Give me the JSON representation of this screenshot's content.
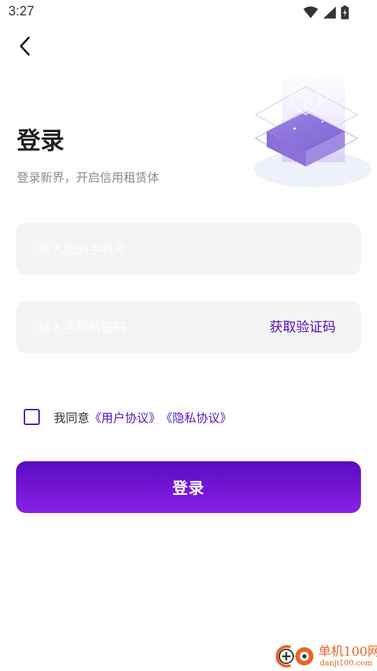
{
  "status_bar": {
    "time": "3:27",
    "icons": [
      "wifi-icon",
      "signal-icon",
      "battery-charging-icon"
    ]
  },
  "header": {
    "back_icon": "chevron-left-icon"
  },
  "login": {
    "title": "登录",
    "subtitle": "登录新界，开启信用租赁体",
    "phone_placeholder": "输入您的手机号",
    "code_placeholder": "输入手机验证码",
    "get_code_label": "获取验证码",
    "agreement": {
      "checked": false,
      "prefix": "我同意",
      "user_agreement": "《用户协议》",
      "privacy_agreement": "《隐私协议》"
    },
    "submit_label": "登录"
  },
  "watermark": {
    "name": "单机100网",
    "url": "danji100.com"
  },
  "colors": {
    "accent": "#5310b5",
    "button_gradient_top": "#5a0bc2",
    "button_gradient_bottom": "#8a21e6",
    "field_background": "#f4f4f4",
    "watermark": "#e3672a"
  }
}
